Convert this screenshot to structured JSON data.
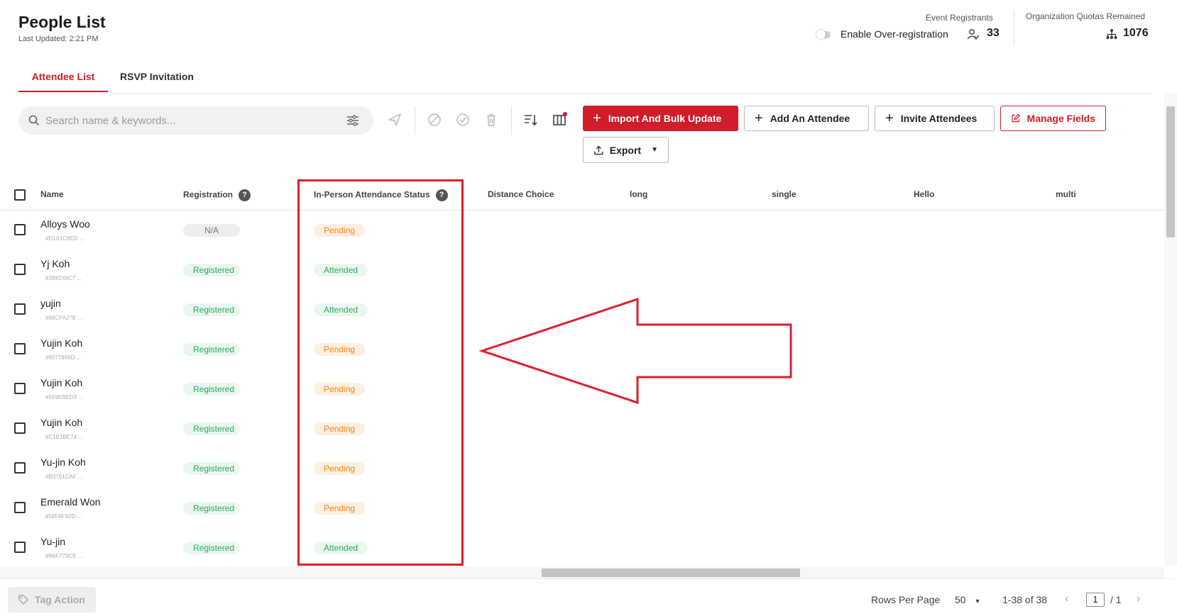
{
  "page": {
    "title": "People List",
    "last_updated": "Last Updated: 2:21 PM"
  },
  "header_stats": {
    "event_registrants_label": "Event Registrants",
    "over_registration_label": "Enable Over-registration",
    "registrants_count": "33",
    "quota_label": "Organization Quotas Remained",
    "quota_count": "1076"
  },
  "tabs": [
    {
      "label": "Attendee List",
      "active": true
    },
    {
      "label": "RSVP Invitation",
      "active": false
    }
  ],
  "toolbar": {
    "search_placeholder": "Search name & keywords...",
    "import_label": "Import And Bulk Update",
    "add_label": "Add An Attendee",
    "invite_label": "Invite Attendees",
    "manage_label": "Manage Fields",
    "export_label": "Export"
  },
  "columns": {
    "name": "Name",
    "registration": "Registration",
    "attendance": "In-Person Attendance Status",
    "distance": "Distance Choice",
    "long": "long",
    "single": "single",
    "hello": "Hello",
    "multi": "multi"
  },
  "rows": [
    {
      "name": "Alloys Woo",
      "id": "#D1A1C6ED ...",
      "registration": "N/A",
      "attendance": "Pending"
    },
    {
      "name": "Yj Koh",
      "id": "#2B8249C7 ...",
      "registration": "Registered",
      "attendance": "Attended"
    },
    {
      "name": "yujin",
      "id": "#66CFA278 ...",
      "registration": "Registered",
      "attendance": "Attended"
    },
    {
      "name": "Yujin Koh",
      "id": "#5077866D ...",
      "registration": "Registered",
      "attendance": "Pending"
    },
    {
      "name": "Yujin Koh",
      "id": "#569EBED3 ...",
      "registration": "Registered",
      "attendance": "Pending"
    },
    {
      "name": "Yujin Koh",
      "id": "#C1E1BE74 ...",
      "registration": "Registered",
      "attendance": "Pending"
    },
    {
      "name": "Yu-jin Koh",
      "id": "#B3761CAF ...",
      "registration": "Registered",
      "attendance": "Pending"
    },
    {
      "name": "Emerald Won",
      "id": "#58F6F92D ...",
      "registration": "Registered",
      "attendance": "Pending"
    },
    {
      "name": "Yu-jin",
      "id": "#B6F773CE ...",
      "registration": "Registered",
      "attendance": "Attended"
    }
  ],
  "footer": {
    "tag_action_label": "Tag Action",
    "rows_per_page_label": "Rows Per Page",
    "rows_per_page_value": "50",
    "range_text": "1-38 of 38",
    "current_page": "1",
    "total_pages": "/ 1"
  },
  "colors": {
    "brand": "#d01c2b",
    "highlight": "#e01e2c",
    "pending_text": "#f08a1a",
    "registered_text": "#2ea863"
  }
}
